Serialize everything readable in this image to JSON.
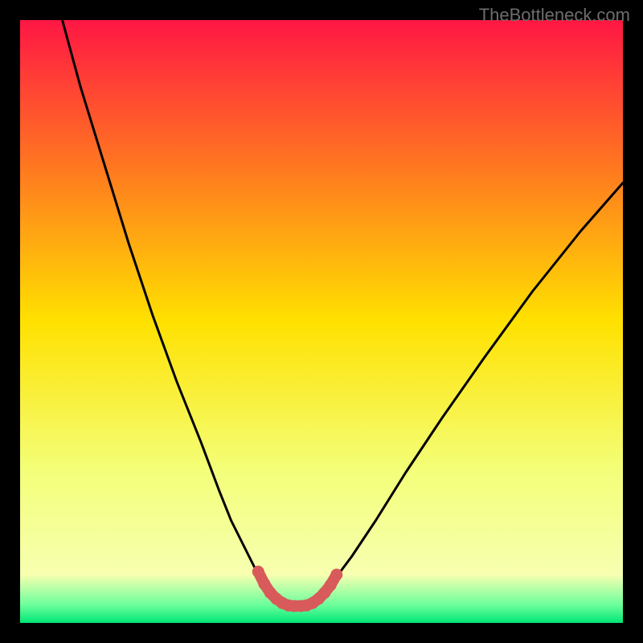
{
  "watermark": "TheBottleneck.com",
  "chart_data": {
    "type": "line",
    "title": "",
    "xlabel": "",
    "ylabel": "",
    "xlim": [
      0,
      100
    ],
    "ylim": [
      0,
      100
    ],
    "gradient_stops": [
      {
        "offset": 0,
        "color": "#ff1744"
      },
      {
        "offset": 25,
        "color": "#ff7a1f"
      },
      {
        "offset": 50,
        "color": "#ffe100"
      },
      {
        "offset": 75,
        "color": "#f3ff7a"
      },
      {
        "offset": 92,
        "color": "#f7ffb0"
      },
      {
        "offset": 97,
        "color": "#6cff9c"
      },
      {
        "offset": 100,
        "color": "#00e676"
      }
    ],
    "series": [
      {
        "name": "left-curve",
        "color": "#000000",
        "x": [
          7,
          10,
          14,
          18,
          22,
          26,
          30,
          33,
          35,
          37,
          39,
          40.5,
          42
        ],
        "y": [
          100,
          89,
          76,
          63,
          51,
          40,
          30,
          22,
          17,
          13,
          9,
          6.5,
          4.5
        ]
      },
      {
        "name": "right-curve",
        "color": "#000000",
        "x": [
          50,
          52,
          55,
          59,
          64,
          70,
          77,
          85,
          93,
          100
        ],
        "y": [
          4.5,
          7,
          11,
          17,
          25,
          34,
          44,
          55,
          65,
          73
        ]
      },
      {
        "name": "sweet-spot",
        "color": "#d85a5a",
        "thick": true,
        "x": [
          39.5,
          40.5,
          41.5,
          42.5,
          43.5,
          44.5,
          45.5,
          46.5,
          47.5,
          48.5,
          49.5,
          50.5,
          51.5,
          52.5
        ],
        "y": [
          8.5,
          6.5,
          5.0,
          4.0,
          3.3,
          2.9,
          2.8,
          2.8,
          2.9,
          3.3,
          4.0,
          5.0,
          6.3,
          8.0
        ]
      }
    ]
  }
}
